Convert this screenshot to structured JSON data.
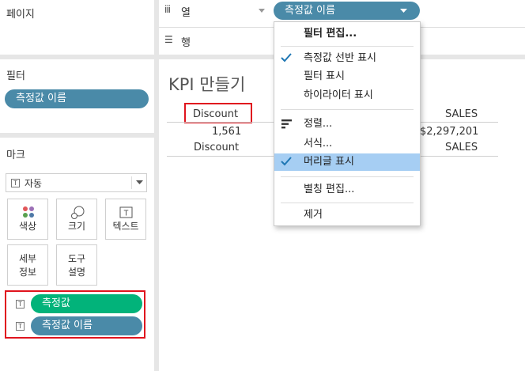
{
  "pages_shelf": {
    "title": "페이지"
  },
  "filters_shelf": {
    "title": "필터",
    "pill": "측정값 이름"
  },
  "marks_shelf": {
    "title": "마크",
    "mark_type": "자동",
    "buttons": {
      "color": "색상",
      "size": "크기",
      "text": "텍스트",
      "detail": "세부\n정보",
      "tooltip": "도구\n설명"
    },
    "pills": [
      "측정값",
      "측정값 이름"
    ]
  },
  "columns_shelf": {
    "icon_text": "iii",
    "title": "열",
    "pill": "측정값 이름"
  },
  "rows_shelf": {
    "icon_text": "☰",
    "title": "행"
  },
  "view": {
    "title": "KPI 만들기",
    "header_discount": "Discount",
    "value_discount": "1,561",
    "footer_discount": "Discount",
    "header_sales": "SALES",
    "value_sales": "$2,297,201",
    "footer_sales": "SALES"
  },
  "context_menu": {
    "items": [
      {
        "label": "필터 편집...",
        "bold": true
      },
      {
        "label": "측정값 선반 표시",
        "checked": true
      },
      {
        "label": "필터 표시"
      },
      {
        "label": "하이라이터 표시"
      },
      {
        "label": "정렬...",
        "icon": "sort-icon"
      },
      {
        "label": "서식..."
      },
      {
        "label": "머리글 표시",
        "checked": true,
        "highlighted": true
      },
      {
        "label": "별칭 편집..."
      },
      {
        "label": "제거"
      }
    ]
  },
  "colors": {
    "pill_blue": "#4a8aa8",
    "pill_green": "#02b37a",
    "highlight_red": "#e0141e",
    "menu_highlight": "#a6cef3"
  }
}
